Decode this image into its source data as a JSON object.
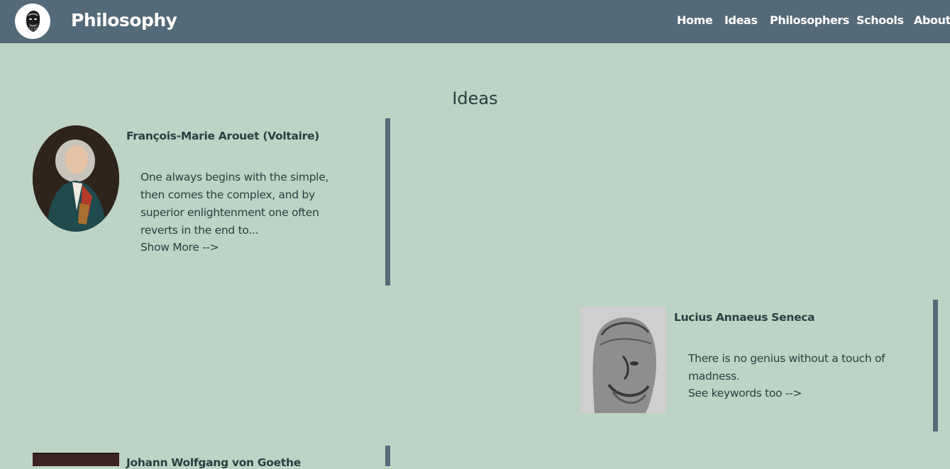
{
  "nav": {
    "brand": "Philosophy",
    "links": [
      "Home",
      "Ideas",
      "Philosophers",
      "Schools",
      "About"
    ]
  },
  "main": {
    "title": "Ideas",
    "cards": [
      {
        "name": "François-Marie Arouet (Voltaire)",
        "quote": "One always begins with the simple, then comes the complex, and by superior enlightenment one often reverts in the end to...",
        "link": "Show More -->"
      },
      {
        "name": "Lucius Annaeus Seneca",
        "quote": "There is no genius without a touch of madness.",
        "link": "See keywords too -->"
      },
      {
        "name": "Johann Wolfgang von Goethe"
      }
    ]
  },
  "colors": {
    "background": "#bcd3c5",
    "navbar": "#546a78",
    "text": "#2c3e40"
  }
}
